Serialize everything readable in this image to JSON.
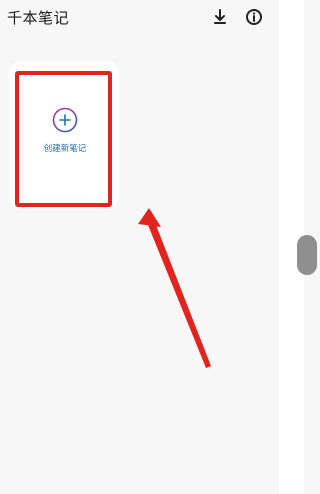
{
  "app": {
    "title": "千本笔记"
  },
  "toolbar": {
    "download_icon": "download-icon",
    "info_icon": "info-icon"
  },
  "note_card": {
    "label": "创建新笔记",
    "icon": "plus-circle-icon"
  },
  "annotation": {
    "box_color": "#e2241f",
    "arrow_color": "#e2241f"
  }
}
